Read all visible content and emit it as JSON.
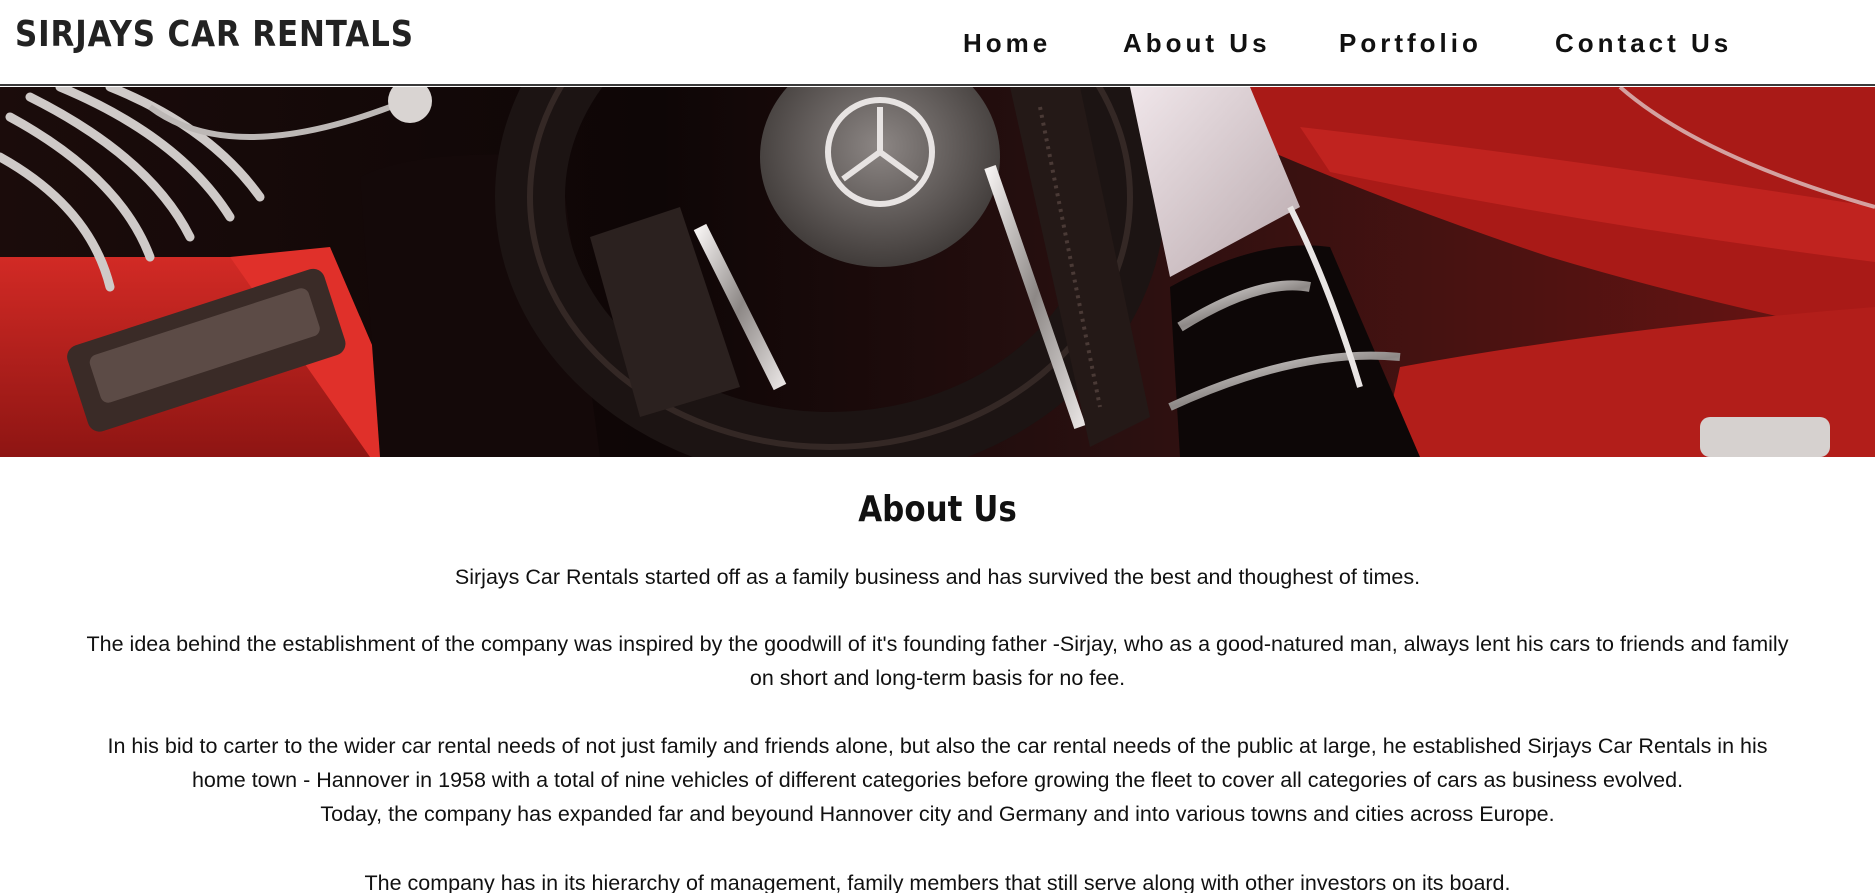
{
  "header": {
    "brand": "SIRJAYS CAR RENTALS",
    "nav": [
      "Home",
      "About Us",
      "Portfolio",
      "Contact Us"
    ]
  },
  "hero": {
    "image": "car-interior-steering-wheel-red-leather",
    "colors": {
      "leather": "#c0201c",
      "dark": "#120707",
      "chrome": "#d8d4d2"
    }
  },
  "about": {
    "heading": "About Us",
    "paragraphs": [
      "Sirjays Car Rentals started off as a family business and has survived the best and thoughest of times.",
      "The idea behind the establishment of the company was inspired by the goodwill of it's founding father -Sirjay, who as a good-natured man, always lent his cars to friends and family on short and long-term basis for no fee.",
      "In his bid to carter to the wider car rental needs of not just family and friends alone, but also the car rental needs of the public at large, he established Sirjays Car Rentals in his home town - Hannover in 1958 with a total of nine vehicles of different categories before growing the fleet to cover all categories of cars as business evolved.",
      "Today, the company has expanded far and beyound Hannover city and Germany and into various towns and cities across Europe.",
      "The company has in its hierarchy of management, family members that still serve along with other investors on its board."
    ]
  }
}
